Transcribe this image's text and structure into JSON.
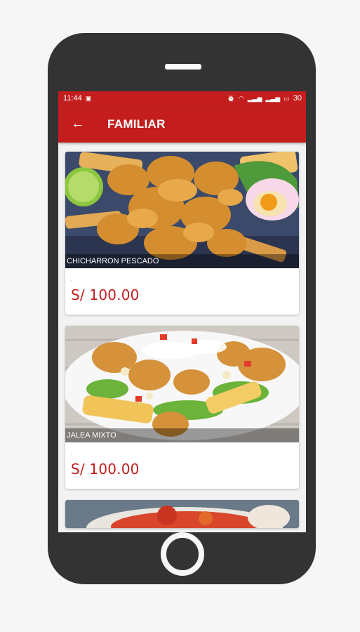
{
  "status_bar": {
    "time": "11:44",
    "battery": "30"
  },
  "app_bar": {
    "title": "FAMILIAR"
  },
  "products": [
    {
      "name": "CHICHARRON PESCADO",
      "description": ".",
      "price": "S/  100.00"
    },
    {
      "name": "JALEA MIXTO",
      "description": ".",
      "price": "S/  100.00"
    }
  ],
  "colors": {
    "primary": "#c31d1d",
    "background": "#f2f2f2",
    "phone": "#333333"
  },
  "icons": [
    "back-arrow-icon",
    "alarm-icon",
    "wifi-icon",
    "signal-icon",
    "battery-icon",
    "gallery-icon"
  ]
}
